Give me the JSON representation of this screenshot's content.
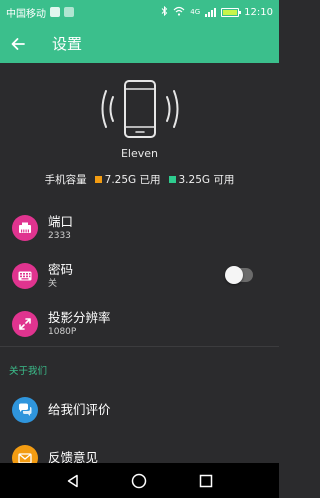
{
  "status_bar": {
    "carrier": "中国移动",
    "network_type": "4G",
    "time": "12:10",
    "background_color": "#3bbf8c"
  },
  "app_bar": {
    "title": "设置",
    "back_icon": "arrow-left-icon"
  },
  "device": {
    "name": "Eleven",
    "storage_label": "手机容量",
    "used_text": "7.25G 已用",
    "available_text": "3.25G 可用",
    "used_color": "#f39c12",
    "available_color": "#2ecc8f"
  },
  "settings": [
    {
      "title": "端口",
      "subtitle": "2333",
      "icon": "ethernet-port-icon",
      "icon_color": "#e0348f"
    },
    {
      "title": "密码",
      "subtitle": "关",
      "icon": "keyboard-icon",
      "icon_color": "#e0348f",
      "toggle": "off"
    },
    {
      "title": "投影分辨率",
      "subtitle": "1080P",
      "icon": "expand-arrows-icon",
      "icon_color": "#e0348f"
    }
  ],
  "about_section": {
    "header": "关于我们",
    "items": [
      {
        "title": "给我们评价",
        "icon": "chat-bubbles-icon",
        "icon_color": "#2f95dc"
      },
      {
        "title": "反馈意见",
        "icon": "feedback-mail-icon",
        "icon_color": "#f39c12"
      }
    ]
  },
  "nav_bar": {
    "buttons": [
      "back-triangle-icon",
      "home-circle-icon",
      "recents-square-icon"
    ]
  }
}
